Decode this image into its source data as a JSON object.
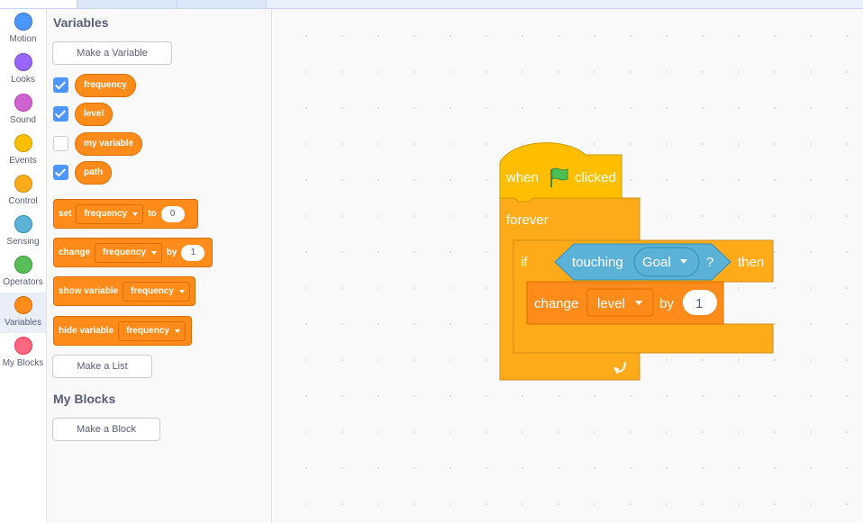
{
  "categories": [
    {
      "label": "Motion",
      "color": "#4c97ff",
      "border": "#3373cc"
    },
    {
      "label": "Looks",
      "color": "#9966ff",
      "border": "#774dcb"
    },
    {
      "label": "Sound",
      "color": "#cf63cf",
      "border": "#bd42bd"
    },
    {
      "label": "Events",
      "color": "#ffbf00",
      "border": "#cc9900"
    },
    {
      "label": "Control",
      "color": "#ffab19",
      "border": "#cf8b17"
    },
    {
      "label": "Sensing",
      "color": "#5cb1d6",
      "border": "#2e8eb8"
    },
    {
      "label": "Operators",
      "color": "#59c059",
      "border": "#389438"
    },
    {
      "label": "Variables",
      "color": "#ff8c1a",
      "border": "#db6e00"
    },
    {
      "label": "My Blocks",
      "color": "#ff6680",
      "border": "#ff3355"
    }
  ],
  "selected_category": "Variables",
  "palette": {
    "variables_title": "Variables",
    "make_variable": "Make a Variable",
    "variables": [
      {
        "name": "frequency",
        "checked": true
      },
      {
        "name": "level",
        "checked": true
      },
      {
        "name": "my variable",
        "checked": false
      },
      {
        "name": "path",
        "checked": true
      }
    ],
    "set_block": {
      "label": "set",
      "var": "frequency",
      "to": "to",
      "value": "0"
    },
    "change_block": {
      "label": "change",
      "var": "frequency",
      "by": "by",
      "value": "1"
    },
    "show_block": {
      "label": "show variable",
      "var": "frequency"
    },
    "hide_block": {
      "label": "hide variable",
      "var": "frequency"
    },
    "make_list": "Make a List",
    "myblocks_title": "My Blocks",
    "make_block": "Make a Block"
  },
  "script": {
    "when": "when",
    "clicked": "clicked",
    "forever": "forever",
    "if": "if",
    "touching": "touching",
    "target": "Goal",
    "question": "?",
    "then": "then",
    "change": "change",
    "var": "level",
    "by": "by",
    "value": "1"
  },
  "colors": {
    "events": "#ffbf00",
    "control": "#ffab19",
    "sensing": "#5cb1d6",
    "variables": "#ff8c1a"
  }
}
